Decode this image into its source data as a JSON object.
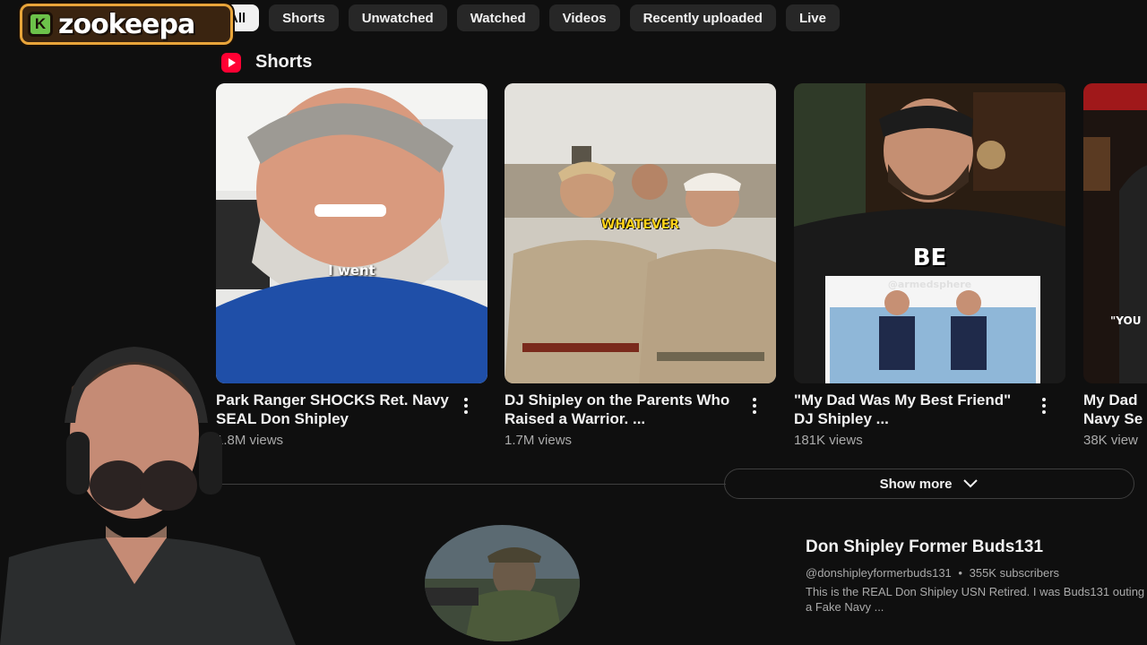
{
  "overlay": {
    "logo_letter": "K",
    "logo_text": "zookeepa"
  },
  "chips": [
    {
      "label": "All",
      "active": true
    },
    {
      "label": "Shorts"
    },
    {
      "label": "Unwatched"
    },
    {
      "label": "Watched"
    },
    {
      "label": "Videos"
    },
    {
      "label": "Recently uploaded"
    },
    {
      "label": "Live"
    }
  ],
  "shorts_section": {
    "title": "Shorts",
    "icon": "youtube-shorts-icon",
    "items": [
      {
        "title": "Park Ranger SHOCKS Ret. Navy SEAL Don Shipley",
        "views": "1.8M views",
        "caption": "I went"
      },
      {
        "title": "DJ Shipley on the Parents Who Raised a Warrior. ...",
        "views": "1.7M views",
        "caption": "WHATEVER"
      },
      {
        "title": "\"My Dad Was My Best Friend\" DJ Shipley ...",
        "views": "181K views",
        "caption": "BE",
        "watermark": "@armedsphere"
      },
      {
        "title": "My Dad ... Navy Se...",
        "title_line1": "My Dad",
        "title_line2": "Navy Se",
        "views": "38K view",
        "caption": "\"YOU"
      }
    ]
  },
  "show_more": {
    "label": "Show more",
    "icon": "chevron-down-icon"
  },
  "channel": {
    "name": "Don Shipley Former Buds131",
    "handle": "@donshipleyformerbuds131",
    "separator": "•",
    "subscribers": "355K subscribers",
    "description": "This is the REAL Don Shipley USN Retired. I was Buds131 outing a Fake Navy ..."
  },
  "colors": {
    "background": "#0f0f0f",
    "chip": "#272727",
    "chip_active": "#f1f1f1",
    "shorts_red": "#ff0033",
    "secondary_text": "#aaaaaa"
  }
}
